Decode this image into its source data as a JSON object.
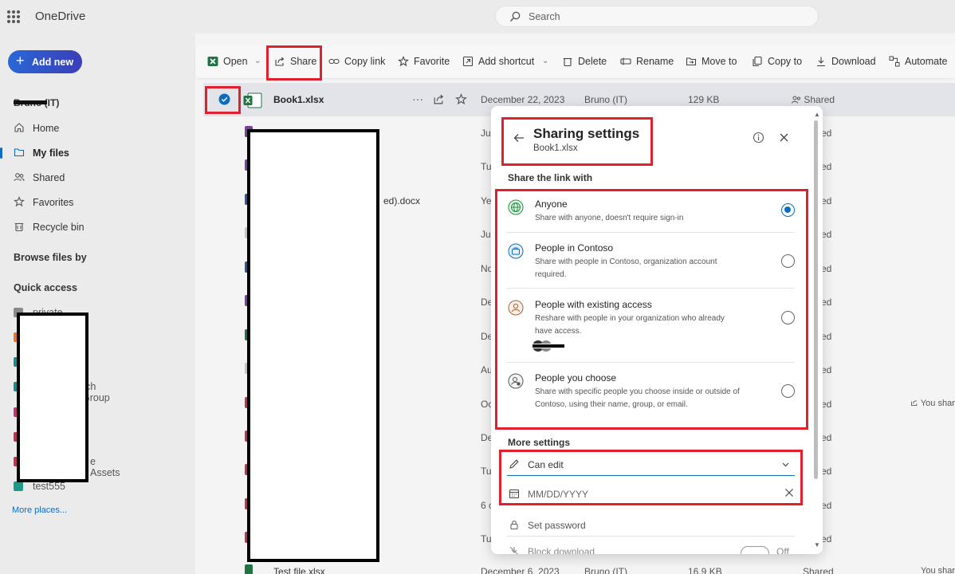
{
  "app": {
    "name": "OneDrive"
  },
  "search": {
    "placeholder": "Search"
  },
  "leftnav": {
    "add_new": "Add new",
    "user": "Bruno (IT)",
    "items": [
      {
        "label": "Home",
        "icon": "home-icon"
      },
      {
        "label": "My files",
        "icon": "folder-icon"
      },
      {
        "label": "Shared",
        "icon": "people-icon"
      },
      {
        "label": "Favorites",
        "icon": "star-icon"
      },
      {
        "label": "Recycle bin",
        "icon": "trash-icon"
      }
    ],
    "browse_files_by": "Browse files by",
    "quick_access": "Quick access",
    "quick_access_items": [
      {
        "label": "private",
        "color": "#8a8a8a"
      },
      {
        "label": "rch Group",
        "color": "#1f8a8a"
      },
      {
        "label": "e Assets",
        "color": "#c4314b"
      },
      {
        "label": "test555",
        "color": "#1f9a8a"
      }
    ],
    "more_places": "More places..."
  },
  "toolbar": {
    "open": "Open",
    "share": "Share",
    "copy_link": "Copy link",
    "favorite": "Favorite",
    "add_shortcut": "Add shortcut",
    "delete": "Delete",
    "rename": "Rename",
    "move_to": "Move to",
    "copy_to": "Copy to",
    "download": "Download",
    "automate": "Automate"
  },
  "files": [
    {
      "name": "Book1.xlsx",
      "modified": "December 22, 2023",
      "modified_by": "Bruno (IT)",
      "size": "129 KB",
      "sharing": "Shared",
      "selected": true,
      "color": "#217346"
    },
    {
      "name": "",
      "modified": "Ju",
      "sharing": "ed",
      "color": "#7b3fa0"
    },
    {
      "name": "",
      "modified": "Tu",
      "sharing": "ed",
      "color": "#7b3fa0"
    },
    {
      "name": "ed).docx",
      "modified": "Ye",
      "sharing": "ed",
      "color": "#2b579a"
    },
    {
      "name": "",
      "modified": "Jul",
      "sharing": "ed",
      "color": "#c4c4c4"
    },
    {
      "name": "",
      "modified": "No",
      "sharing": "ed",
      "color": "#2b579a"
    },
    {
      "name": "",
      "modified": "De",
      "sharing": "ed",
      "color": "#7b3fa0"
    },
    {
      "name": "",
      "modified": "De",
      "sharing": "ed",
      "color": "#217346"
    },
    {
      "name": "",
      "modified": "Au",
      "sharing": "ed",
      "color": "#c4c4c4"
    },
    {
      "name": "",
      "modified": "Oc",
      "sharing": "ed",
      "extra": "You shar",
      "color": "#c4314b"
    },
    {
      "name": "",
      "modified": "De",
      "sharing": "ed",
      "color": "#c4314b"
    },
    {
      "name": "",
      "modified": "Tu",
      "sharing": "ed",
      "color": "#c4314b"
    },
    {
      "name": "",
      "modified": "6 c",
      "sharing": "ed",
      "color": "#c4314b"
    },
    {
      "name": "",
      "modified": "Tu",
      "sharing": "ed",
      "color": "#c4314b"
    },
    {
      "name": "Test file.xlsx",
      "modified": "December 6, 2023",
      "modified_by": "Bruno (IT)",
      "size": "16.9 KB",
      "sharing": "Shared",
      "extra": "You shar",
      "color": "#217346"
    }
  ],
  "dialog": {
    "title": "Sharing settings",
    "file_name": "Book1.xlsx",
    "share_link_with": "Share the link with",
    "options": [
      {
        "title": "Anyone",
        "desc": "Share with anyone, doesn't require sign-in",
        "selected": true,
        "icon": "globe-icon"
      },
      {
        "title": "People in Contoso",
        "desc": "Share with people in Contoso, organization account required.",
        "selected": false,
        "icon": "briefcase-icon"
      },
      {
        "title": "People with existing access",
        "desc": "Reshare with people in your organization who already have access.",
        "selected": false,
        "icon": "person-icon"
      },
      {
        "title": "People you choose",
        "desc": "Share with specific people you choose inside or outside of Contoso, using their name, group, or email.",
        "selected": false,
        "icon": "person-settings-icon"
      }
    ],
    "more_settings": "More settings",
    "permission": "Can edit",
    "expiration_placeholder": "MM/DD/YYYY",
    "set_password": "Set password",
    "block_download": "Block download",
    "block_download_state": "Off"
  }
}
